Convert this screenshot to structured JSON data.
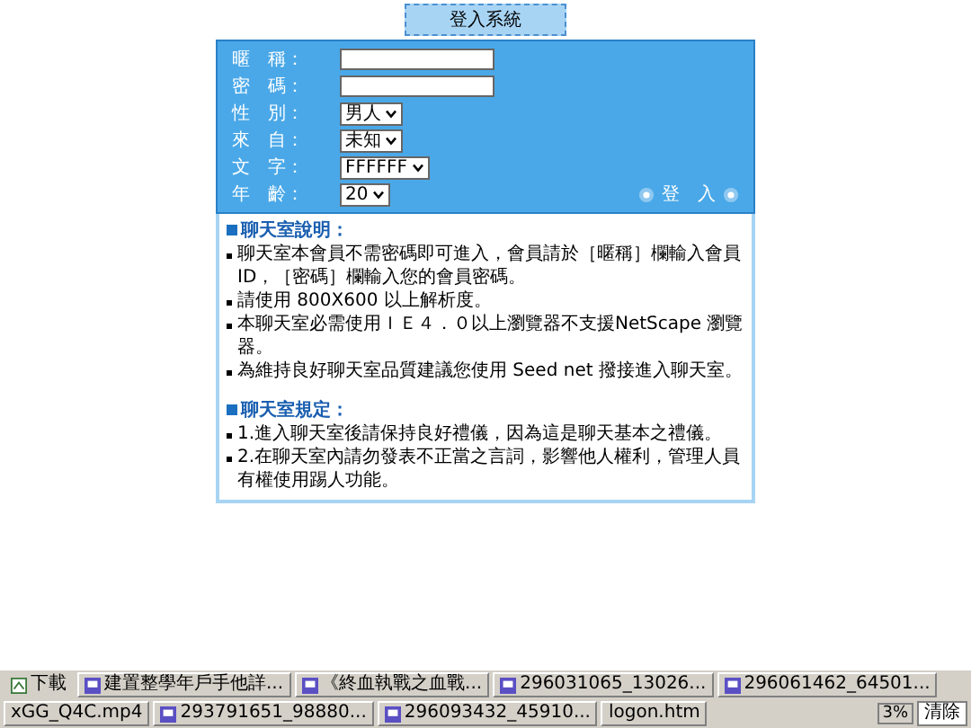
{
  "title": "登入系統",
  "form": {
    "fields": [
      {
        "label": "暱　稱：",
        "kind": "text"
      },
      {
        "label": "密　碼：",
        "kind": "password"
      },
      {
        "label": "性　別：",
        "kind": "select",
        "value": "男人"
      },
      {
        "label": "來　自：",
        "kind": "select",
        "value": "未知"
      },
      {
        "label": "文　字：",
        "kind": "select",
        "value": "FFFFFF"
      },
      {
        "label": "年　齡：",
        "kind": "select",
        "value": "20"
      }
    ],
    "login_button": "登　入"
  },
  "info_sections": [
    {
      "heading": "聊天室說明：",
      "items": [
        "聊天室本會員不需密碼即可進入，會員請於［暱稱］欄輸入會員ID，［密碼］欄輸入您的會員密碼。",
        "請使用 800X600 以上解析度。",
        "本聊天室必需使用ＩＥ４．０以上瀏覽器不支援NetScape 瀏覽器。",
        "為維持良好聊天室品質建議您使用 Seed net 撥接進入聊天室。"
      ]
    },
    {
      "heading": "聊天室規定：",
      "items": [
        "1.進入聊天室後請保持良好禮儀，因為這是聊天基本之禮儀。",
        "2.在聊天室內請勿發表不正當之言詞，影響他人權利，管理人員有權使用踢人功能。"
      ]
    }
  ],
  "taskbar": {
    "items": [
      {
        "label": "下載",
        "kind": "launcher"
      },
      {
        "label": "建置整學年戶手他詳...",
        "kind": "video"
      },
      {
        "label": "《終血執戰之血戰...",
        "kind": "video"
      },
      {
        "label": "296031065_13026...",
        "kind": "video"
      },
      {
        "label": "296061462_64501...",
        "kind": "video"
      },
      {
        "label": "xGG_Q4C.mp4",
        "kind": "file"
      },
      {
        "label": "293791651_98880...",
        "kind": "video"
      },
      {
        "label": "296093432_45910...",
        "kind": "video"
      },
      {
        "label": "logon.htm",
        "kind": "file"
      }
    ],
    "battery": "3%",
    "clear_button": "清除"
  }
}
